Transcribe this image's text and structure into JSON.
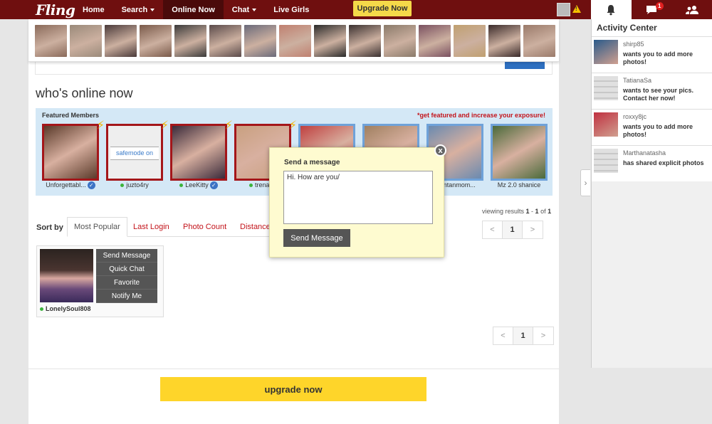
{
  "nav": {
    "logo": "Fling",
    "items": [
      {
        "label": "Home",
        "dropdown": false,
        "active": false
      },
      {
        "label": "Search",
        "dropdown": true,
        "active": false
      },
      {
        "label": "Online Now",
        "dropdown": false,
        "active": true
      },
      {
        "label": "Chat",
        "dropdown": true,
        "active": false
      },
      {
        "label": "Live Girls",
        "dropdown": false,
        "active": false
      }
    ],
    "upgrade_label": "Upgrade Now",
    "notification_badge": "1"
  },
  "page": {
    "title": "who's online now"
  },
  "featured": {
    "label": "Featured Members",
    "promo": "*get featured and increase your exposure!",
    "safemode_text": "safemode on",
    "members": [
      {
        "name": "Unforgettabl...",
        "verified": true,
        "online": false,
        "boosted": true,
        "color": "#5a3a2a"
      },
      {
        "name": "juzto4ry",
        "verified": false,
        "online": true,
        "boosted": true,
        "color": "#d9d9d9",
        "safemode": true
      },
      {
        "name": "LeeKitty",
        "verified": true,
        "online": true,
        "boosted": true,
        "color": "#3a2a3a"
      },
      {
        "name": "trenaxe",
        "verified": false,
        "online": true,
        "boosted": true,
        "color": "#c9a080"
      },
      {
        "name": "",
        "verified": false,
        "online": false,
        "boosted": false,
        "color": "#c04040"
      },
      {
        "name": "",
        "verified": false,
        "online": false,
        "boosted": false,
        "color": "#a08060"
      },
      {
        "name": "...entanmom...",
        "verified": false,
        "online": false,
        "boosted": false,
        "color": "#6a8ab0"
      },
      {
        "name": "Mz 2.0 shanice",
        "verified": false,
        "online": false,
        "boosted": false,
        "color": "#4a6a3a"
      }
    ]
  },
  "sort": {
    "label": "Sort by",
    "tabs": [
      "Most Popular",
      "Last Login",
      "Photo Count",
      "Distance"
    ],
    "active": "Most Popular"
  },
  "results": {
    "prefix": "viewing results ",
    "start": "1",
    "sep": " - ",
    "end": "1",
    "of": " of ",
    "total": "1"
  },
  "pager": {
    "prev": "<",
    "current": "1",
    "next": ">"
  },
  "member_card": {
    "name": "LonelySoul808",
    "online": true,
    "actions": [
      "Send Message",
      "Quick Chat",
      "Favorite",
      "Notify Me"
    ]
  },
  "upgrade_bottom": "upgrade now",
  "activity": {
    "title": "Activity Center",
    "items": [
      {
        "user": "shirp85",
        "message": "wants you to add more photos!",
        "color": "#2a5a8a"
      },
      {
        "user": "TatianaSa",
        "message": "wants to see your pics. Contact her now!",
        "color": "#d0d0d0"
      },
      {
        "user": "roxxy8jc",
        "message": "wants you to add more photos!",
        "color": "#c03040"
      },
      {
        "user": "Marthanatasha",
        "message": "has shared explicit photos",
        "color": "#d0d0d0"
      }
    ]
  },
  "popup": {
    "title": "Send a message",
    "message": "Hi. How are you/",
    "send_label": "Send Message",
    "close": "x"
  },
  "strip_colors": [
    "#8a6a5a",
    "#9a8a7a",
    "#4a3a3a",
    "#7a5a4a",
    "#3a3a3a",
    "#5a4a4a",
    "#6a6a7a",
    "#c08070",
    "#2a2a2a",
    "#3a3030",
    "#8a7a6a",
    "#7a5060",
    "#c0a070",
    "#3a2a2a",
    "#9a7a6a"
  ]
}
